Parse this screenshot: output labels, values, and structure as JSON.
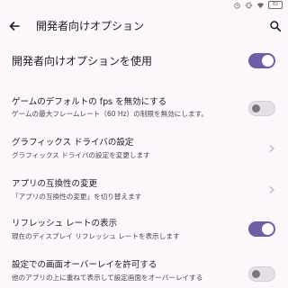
{
  "status_bar": {
    "icons": [
      "alarm-icon",
      "vibrate-icon",
      "wifi-icon",
      "battery-icon"
    ],
    "battery_level": "82"
  },
  "app_bar": {
    "title": "開発者向けオプション",
    "back_icon": "arrow-back-icon",
    "search_icon": "search-icon"
  },
  "main_toggle": {
    "label": "開発者向けオプションを使用",
    "state": "on"
  },
  "items": [
    {
      "title": "ゲームのデフォルトの fps を無効にする",
      "subtitle": "ゲームの最大フレームレート（60 Hz）の制限を無効にします。",
      "control": "switch",
      "state": "off"
    },
    {
      "title": "グラフィックス ドライバの設定",
      "subtitle": "グラフィックス ドライバの設定を変更します",
      "control": "chevron"
    },
    {
      "title": "アプリの互換性の変更",
      "subtitle": "「アプリの互換性の変更」を切り替えます",
      "control": "chevron"
    },
    {
      "title": "リフレッシュ レートの表示",
      "subtitle": "現在のディスプレイ リフレッシュ レートを表示します",
      "control": "switch",
      "state": "on"
    },
    {
      "title": "設定での画面オーバーレイを許可する",
      "subtitle": "他のアプリの上に重ねて表示して設定画面をオーバーレイする",
      "control": "switch",
      "state": "off"
    }
  ],
  "colors": {
    "background": "#fdf7fc",
    "accent": "#6d5ea8"
  }
}
